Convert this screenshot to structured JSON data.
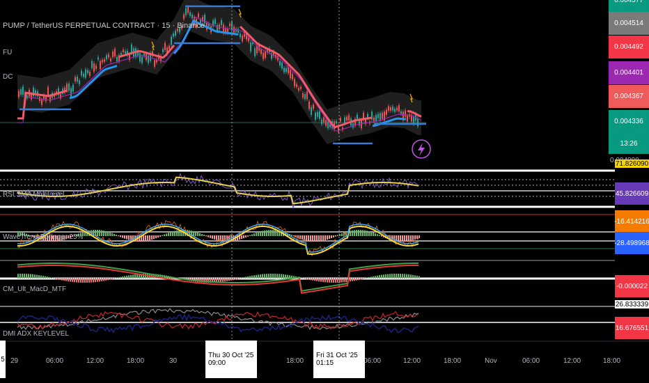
{
  "chart_title": "PUMP / TetherUS PERPETUAL CONTRACT · 15 · Binance",
  "indicator_labels": {
    "fu": "FU",
    "dc": "DC",
    "rsi": "RSI SMA MultiLevel",
    "wt": "WaveTrend Bollinger 25%",
    "macd": "CM_Ult_MacD_MTF",
    "dmi": "DMI ADX KEYLEVEL"
  },
  "price_tags": [
    {
      "value": "0.004577",
      "color": "#089981"
    },
    {
      "value": "0.004514",
      "color": "#7a7a7a"
    },
    {
      "value": "0.004492",
      "color": "#f23645"
    },
    {
      "value": "0.004401",
      "color": "#9c27b0"
    },
    {
      "value": "0.004367",
      "color": "#f05a5a"
    },
    {
      "value": "0.004336",
      "color": "#089981"
    },
    {
      "value": "13:26",
      "color": "#089981"
    }
  ],
  "axis_small_label": "0.004000",
  "oscillator_tags": [
    {
      "value": "71.826090",
      "color": "#f5d400"
    },
    {
      "value": "45.826609",
      "color": "#673ab7"
    },
    {
      "value": "-16.414216",
      "color": "#f57c00"
    },
    {
      "value": "-28.498968",
      "color": "#2962ff"
    },
    {
      "value": "-0.000022",
      "color": "#f23645"
    },
    {
      "value": "26.833339",
      "color": "#ffffff"
    },
    {
      "value": "16.676551",
      "color": "#f23645"
    }
  ],
  "time_axis": {
    "labels": [
      "29",
      "06:00",
      "12:00",
      "18:00",
      "30",
      "12:00",
      "18:00",
      "12:00",
      "18:00",
      "Nov",
      "06:00",
      "12:00",
      "18:00"
    ],
    "highlight_left": "Thu 30 Oct '25  09:00",
    "highlight_right": "Fri 31 Oct '25  01:15",
    "edge_left": "5"
  },
  "icons": {
    "flash": "lightning-icon"
  }
}
